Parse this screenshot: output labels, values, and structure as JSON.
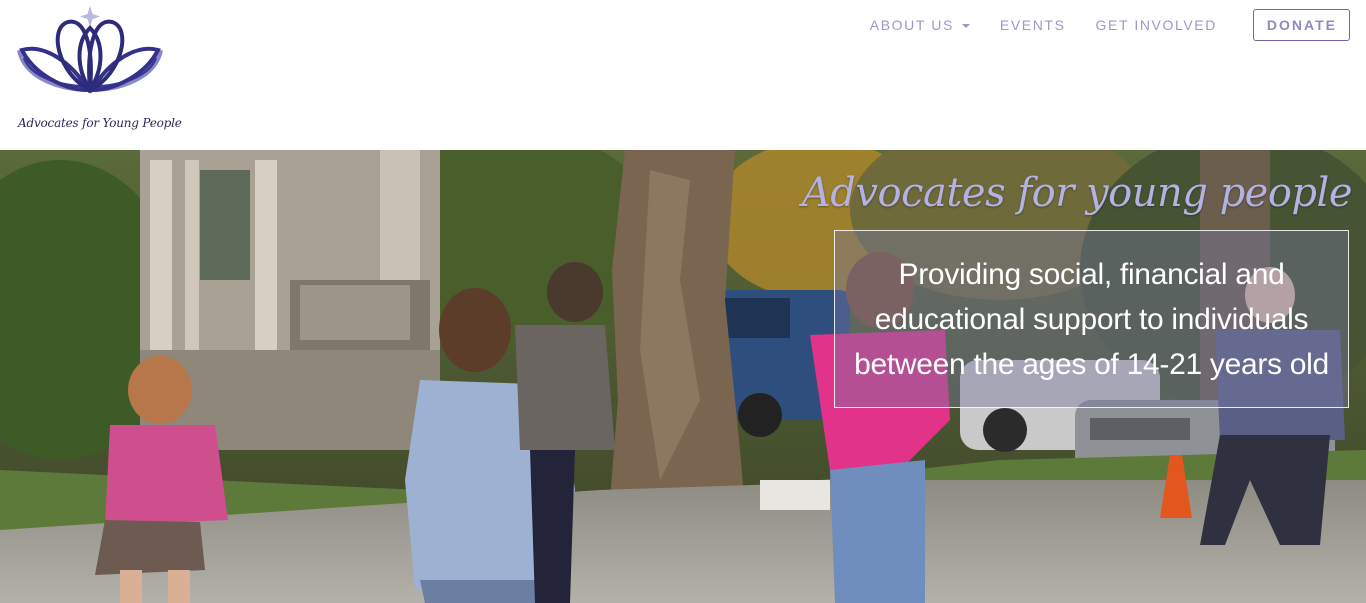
{
  "header": {
    "logo": {
      "text": "Advocates for Young People",
      "icon": "lotus-logo-icon"
    },
    "nav": {
      "items": [
        {
          "label": "ABOUT US",
          "has_dropdown": true
        },
        {
          "label": "EVENTS"
        },
        {
          "label": "GET INVOLVED"
        }
      ],
      "donate_label": "DONATE"
    }
  },
  "hero": {
    "title": "Advocates for young people",
    "tagline": "Providing social, financial and educational support to individuals between the ages of 14-21 years old"
  },
  "colors": {
    "brand_purple": "#2e2b7a",
    "brand_lavender": "#9a9ac8",
    "nav_text": "#9a9ac8",
    "hero_title": "#b3b2e2"
  }
}
